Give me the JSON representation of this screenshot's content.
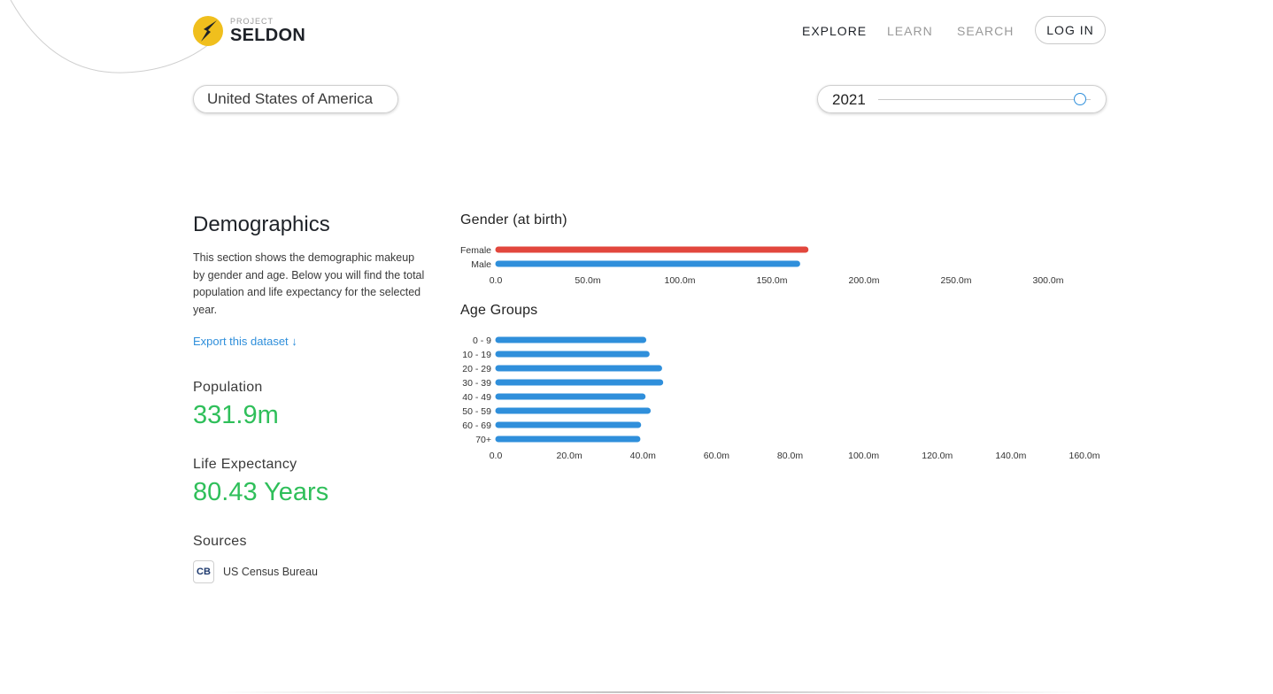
{
  "header": {
    "logo": {
      "small": "PROJECT",
      "big": "SELDON"
    },
    "nav": [
      {
        "label": "EXPLORE",
        "active": true
      },
      {
        "label": "LEARN",
        "active": false
      },
      {
        "label": "SEARCH",
        "active": false
      }
    ],
    "login_label": "LOG IN"
  },
  "controls": {
    "country": "United States of America",
    "year": "2021",
    "year_slider_fraction": 0.95
  },
  "demographics": {
    "title": "Demographics",
    "description": "This section shows the demographic makeup by gender and age. Below you will find the total population and life expectancy for the selected year.",
    "export_label": "Export this dataset ↓",
    "population_label": "Population",
    "population_value": "331.9m",
    "life_expectancy_label": "Life Expectancy",
    "life_expectancy_value": "80.43 Years",
    "sources_label": "Sources",
    "sources": [
      {
        "badge": "CB",
        "name": "US Census Bureau"
      }
    ]
  },
  "colors": {
    "female": "#e2473d",
    "male": "#2f8fdb",
    "accent_green": "#2fbf5a",
    "link": "#2f8fdb",
    "logo_yellow": "#f0bf1d"
  },
  "chart_data": [
    {
      "type": "bar",
      "orientation": "horizontal",
      "title": "Gender (at birth)",
      "categories": [
        "Female",
        "Male"
      ],
      "values": [
        169.6,
        165.1
      ],
      "colors": [
        "#e2473d",
        "#2f8fdb"
      ],
      "xlim": [
        0,
        300
      ],
      "ticks": [
        0,
        50,
        100,
        150,
        200,
        250,
        300
      ],
      "tick_labels": [
        "0.0",
        "50.0m",
        "100.0m",
        "150.0m",
        "200.0m",
        "250.0m",
        "300.0m"
      ]
    },
    {
      "type": "bar",
      "orientation": "horizontal",
      "title": "Age Groups",
      "categories": [
        "0 - 9",
        "10 - 19",
        "20 - 29",
        "30 - 39",
        "40 - 49",
        "50 - 59",
        "60 - 69",
        "70+"
      ],
      "values": [
        40.8,
        41.7,
        45.1,
        45.4,
        40.6,
        42.0,
        39.4,
        39.2
      ],
      "colors": [
        "#2f8fdb"
      ],
      "xlim": [
        0,
        160
      ],
      "ticks": [
        0,
        20,
        40,
        60,
        80,
        100,
        120,
        140,
        160
      ],
      "tick_labels": [
        "0.0",
        "20.0m",
        "40.0m",
        "60.0m",
        "80.0m",
        "100.0m",
        "120.0m",
        "140.0m",
        "160.0m"
      ]
    }
  ]
}
